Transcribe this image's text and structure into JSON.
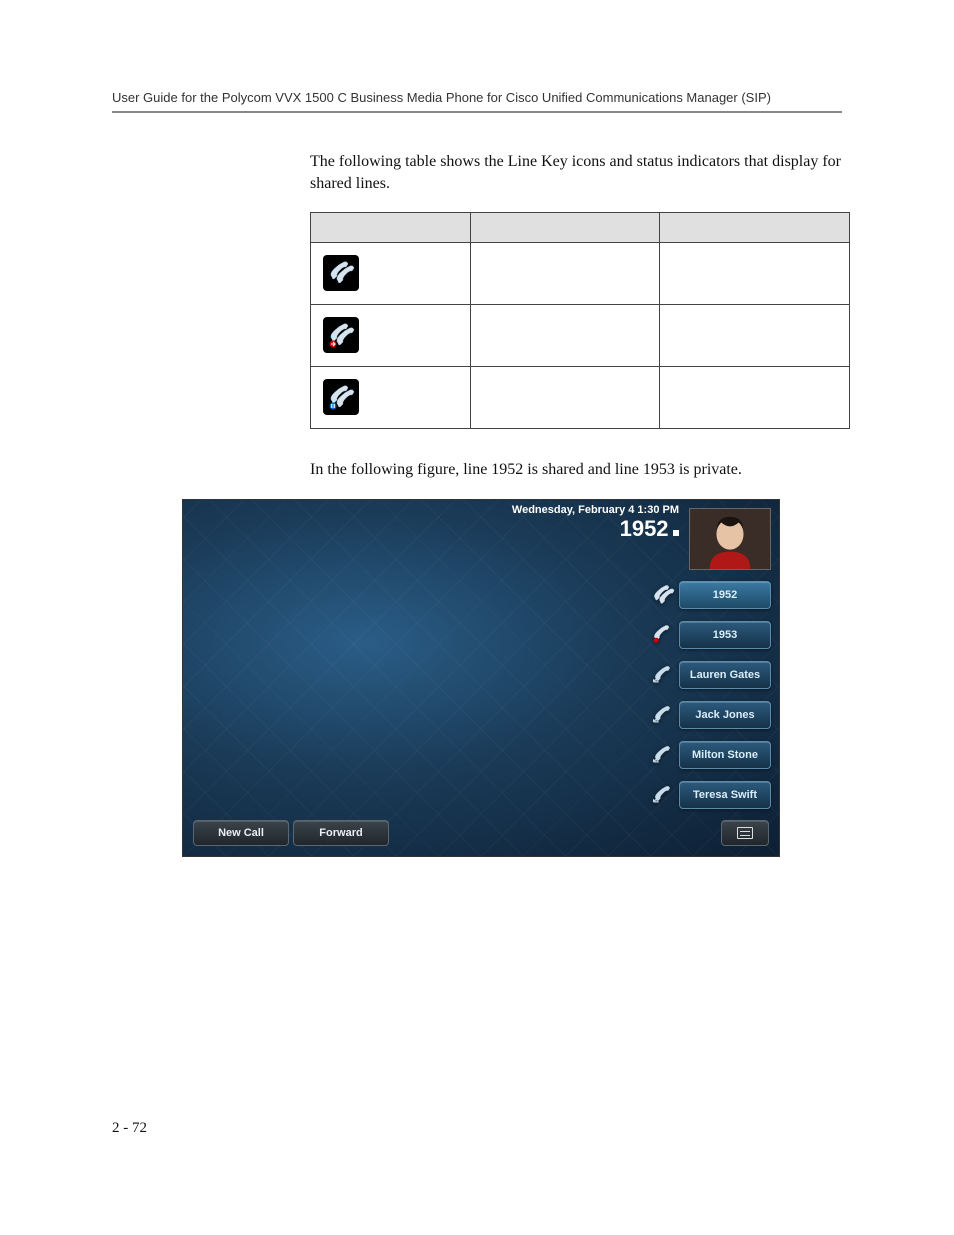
{
  "header": {
    "title": "User Guide for the Polycom VVX 1500 C Business Media Phone for Cisco Unified Communications Manager (SIP)"
  },
  "paragraphs": {
    "intro": "The following table shows the Line Key icons and status indicators that display for shared lines.",
    "caption": "In the following figure, line 1952 is shared and line 1953 is private."
  },
  "table": {
    "rows": [
      {
        "icon": "shared-handset-normal"
      },
      {
        "icon": "shared-handset-arrow"
      },
      {
        "icon": "shared-handset-hold"
      }
    ]
  },
  "phone": {
    "date": "Wednesday, February 4  1:30 PM",
    "current_line": "1952",
    "keys": [
      {
        "type": "shared-line",
        "label": "1952",
        "active": true
      },
      {
        "type": "private-line",
        "label": "1953",
        "active": false
      },
      {
        "type": "contact",
        "label": "Lauren Gates"
      },
      {
        "type": "contact",
        "label": "Jack Jones"
      },
      {
        "type": "contact",
        "label": "Milton Stone"
      },
      {
        "type": "contact",
        "label": "Teresa Swift"
      }
    ],
    "softkeys": {
      "new_call": "New Call",
      "forward": "Forward"
    }
  },
  "page_number": "2 - 72",
  "colors": {
    "phone_bg_dark": "#0d1f33",
    "phone_bg_light": "#2a5d87",
    "key_border": "#5a8bab"
  }
}
